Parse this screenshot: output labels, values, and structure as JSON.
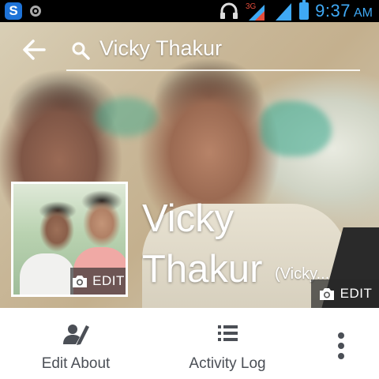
{
  "status_bar": {
    "time": "9:37",
    "ampm": "AM",
    "network_label": "3G",
    "icons": [
      "s-app-icon",
      "circle-app-icon",
      "headset-icon",
      "signal-3g-icon",
      "signal-icon",
      "battery-icon"
    ]
  },
  "header": {
    "search_title": "Vicky Thakur",
    "icons": [
      "back-arrow-icon",
      "search-icon"
    ]
  },
  "profile": {
    "name": "Vicky Thakur",
    "alternate_name": "(Vicky...",
    "profile_picture_edit_label": "EDIT",
    "cover_edit_label": "EDIT"
  },
  "actions": {
    "edit_about_label": "Edit About",
    "activity_log_label": "Activity Log",
    "icons": [
      "edit-person-icon",
      "list-icon",
      "overflow-menu-icon"
    ]
  },
  "colors": {
    "status_accent": "#3fa9f5",
    "action_text": "#4b4f56",
    "action_icon": "#4b4f56"
  }
}
